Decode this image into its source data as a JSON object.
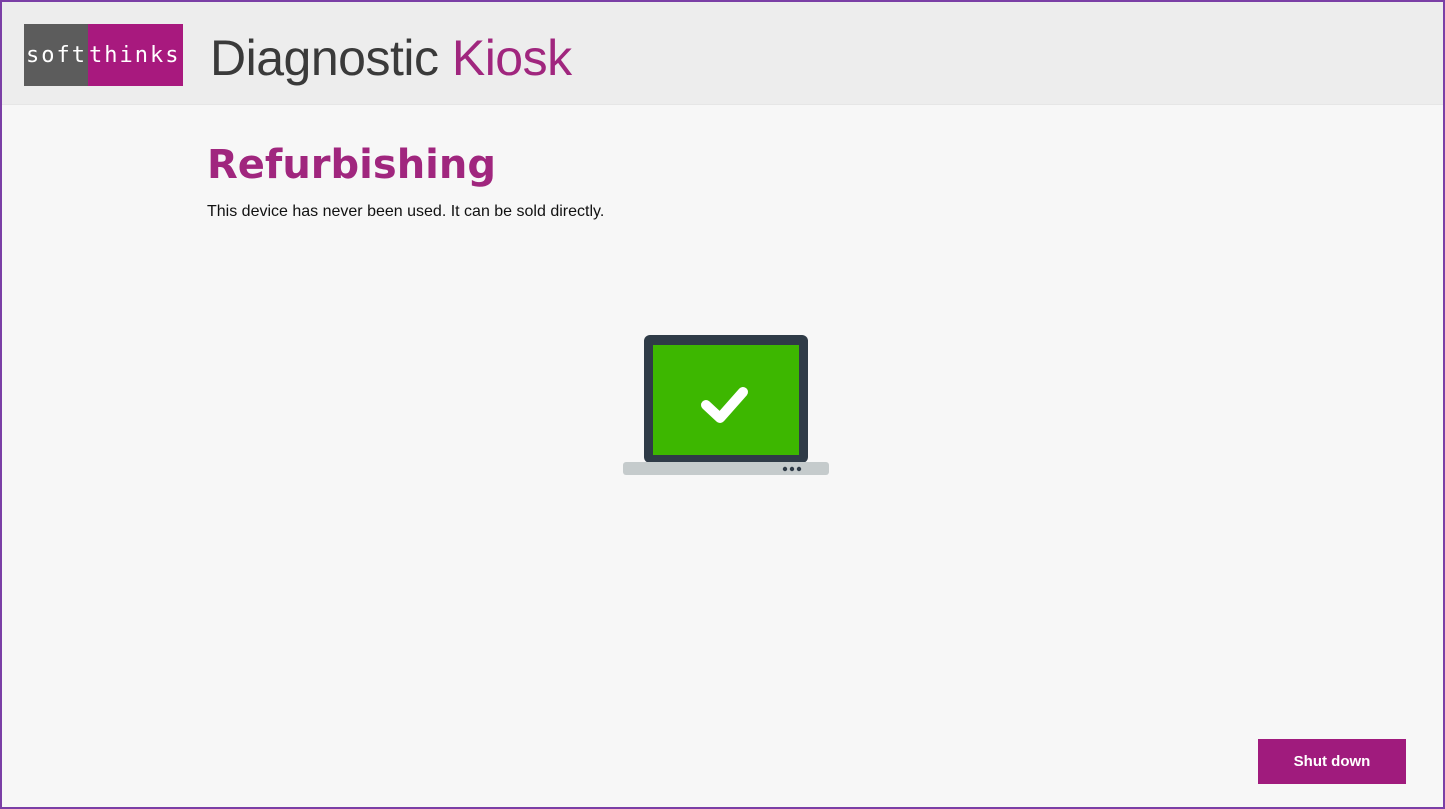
{
  "header": {
    "logo": {
      "part1": "soft",
      "part2": "thinks"
    },
    "title_main": "Diagnostic ",
    "title_accent": "Kiosk"
  },
  "main": {
    "title": "Refurbishing",
    "subtitle": "This device has never been used. It can be sold directly.",
    "status_icon": "laptop-check-icon"
  },
  "footer": {
    "shutdown_label": "Shut down"
  },
  "colors": {
    "brand_purple": "#a0267e",
    "logo_gray": "#5c5c5c",
    "success_green": "#3db700",
    "screen_frame": "#2f3b47",
    "laptop_base": "#c5cbcc"
  }
}
